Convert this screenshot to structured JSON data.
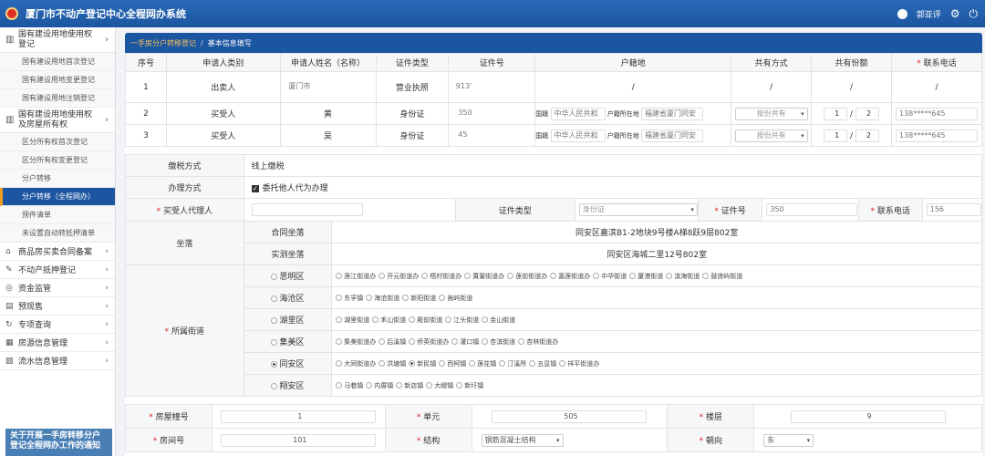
{
  "header": {
    "title": "厦门市不动产登记中心全程网办系统",
    "username": "郭亚评"
  },
  "sidebar": {
    "groups": [
      {
        "label": "国有建设用地使用权登记"
      },
      {
        "label": "国有建设用地使用权及房屋所有权"
      }
    ],
    "sub1": [
      "国有建设用地首次登记",
      "国有建设用地变更登记",
      "国有建设用地注销登记"
    ],
    "sub2": [
      "区分所有权首次登记",
      "区分所有权变更登记",
      "分户转移",
      "分户转移（全程网办）",
      "预件清单",
      "未设置自动转抵押清单"
    ],
    "menus": [
      "商品房买卖合同备案",
      "不动产抵押登记",
      "资金监管",
      "预现售",
      "专项查询",
      "房源信息管理",
      "流水信息管理"
    ],
    "notice": "关于开展一手房转移分户登记全程网办工作的通知"
  },
  "breadcrumb": {
    "item1": "一手房分户转移登记",
    "item2": "基本信息填写"
  },
  "applicants": {
    "headers": [
      "序号",
      "申请人类别",
      "申请人姓名（名称）",
      "证件类型",
      "证件号",
      "户籍地",
      "共有方式",
      "共有份额",
      "联系电话"
    ],
    "rows": [
      {
        "no": "1",
        "type": "出卖人",
        "name": "厦门市",
        "idtype": "营业执照",
        "idno": "913'",
        "huji": "/",
        "share_mode": "/",
        "share": "/",
        "phone": "/"
      },
      {
        "no": "2",
        "type": "买受人",
        "name": "黄",
        "idtype": "身份证",
        "idno": "350",
        "country_lbl": "国籍",
        "country": "中华人民共和",
        "place_lbl": "户籍所在地",
        "place": "福建省厦门同安",
        "share_mode": "按份共有",
        "share_a": "1",
        "share_b": "2",
        "phone": "138*****645"
      },
      {
        "no": "3",
        "type": "买受人",
        "name": "吴",
        "idtype": "身份证",
        "idno": "45",
        "country_lbl": "国籍",
        "country": "中华人民共和",
        "place_lbl": "户籍所在地",
        "place": "福建省厦门同安",
        "share_mode": "按份共有",
        "share_a": "1",
        "share_b": "2",
        "phone": "138*****645"
      }
    ]
  },
  "form": {
    "tax_label": "缴税方式",
    "tax_value": "线上缴税",
    "handle_label": "办理方式",
    "handle_value": "委托他人代为办理",
    "agent_label": "买受人代理人",
    "idtype_label": "证件类型",
    "idtype_value": "身份证",
    "idno_label": "证件号",
    "idno_value": "350",
    "phone_label": "联系电话",
    "phone_value": "156",
    "location_label": "坐落",
    "contract_loc_label": "合同坐落",
    "contract_loc": "同安区嘉滨B1-2地块9号楼A梯8跃9层802室",
    "survey_loc_label": "实测坐落",
    "survey_loc": "同安区海城二里12号802室",
    "street_label": "所属街道",
    "districts": [
      {
        "name": "思明区",
        "selected": false,
        "streets": [
          "莲江街道办",
          "开元街道办",
          "梧村街道办",
          "篔簹街道办",
          "莲前街道办",
          "嘉莲街道办",
          "中华街道",
          "厦港街道",
          "滨海街道",
          "鼓浪屿街道"
        ]
      },
      {
        "name": "海沧区",
        "selected": false,
        "streets": [
          "东孚镇",
          "海沧街道",
          "新阳街道",
          "嵩屿街道"
        ]
      },
      {
        "name": "湖里区",
        "selected": false,
        "streets": [
          "湖里街道",
          "禾山街道",
          "殿前街道",
          "江头街道",
          "金山街道"
        ]
      },
      {
        "name": "集美区",
        "selected": false,
        "streets": [
          "集美街道办",
          "后溪镇",
          "侨英街道办",
          "灌口镇",
          "杏滨街道",
          "杏林街道办"
        ]
      },
      {
        "name": "同安区",
        "selected": true,
        "streets": [
          "大同街道办",
          "洪塘镇",
          "新民镇",
          "西柯镇",
          "莲花镇",
          "汀溪所",
          "五显镇",
          "祥平街道办"
        ]
      },
      {
        "name": "翔安区",
        "selected": false,
        "streets": [
          "马巷镇",
          "内厝镇",
          "新店镇",
          "大嶝镇",
          "新圩镇"
        ]
      }
    ],
    "building_label": "房屋幢号",
    "building_value": "1",
    "unit_label": "单元",
    "unit_value": "505",
    "floor_label": "楼层",
    "floor_value": "9",
    "room_label": "房间号",
    "room_value": "101",
    "structure_label": "结构",
    "structure_value": "钢筋混凝土结构",
    "orient_label": "朝向",
    "orient_value": "东"
  }
}
